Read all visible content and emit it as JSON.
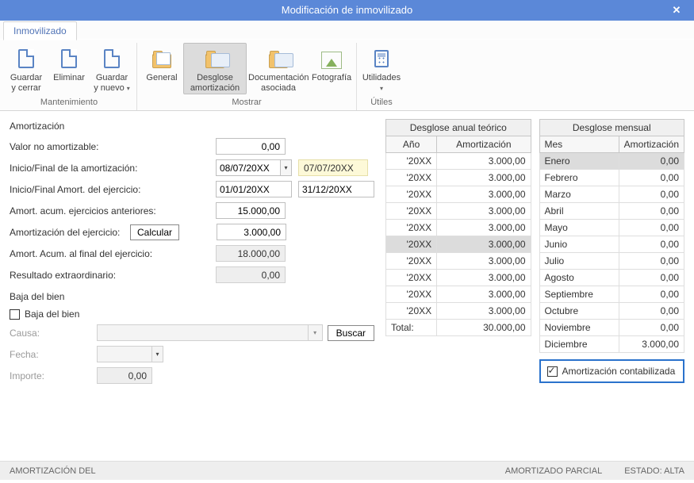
{
  "window": {
    "title": "Modificación de inmovilizado"
  },
  "tabs": {
    "main": "Inmovilizado"
  },
  "ribbon": {
    "groups": [
      {
        "title": "Mantenimiento",
        "items": [
          {
            "id": "guardar-cerrar",
            "line1": "Guardar",
            "line2": "y cerrar"
          },
          {
            "id": "eliminar",
            "line1": "Eliminar",
            "line2": ""
          },
          {
            "id": "guardar-nuevo",
            "line1": "Guardar",
            "line2": "y nuevo",
            "drop": true
          }
        ]
      },
      {
        "title": "Mostrar",
        "items": [
          {
            "id": "general",
            "line1": "General",
            "line2": ""
          },
          {
            "id": "desglose-amort",
            "line1": "Desglose",
            "line2": "amortización",
            "active": true
          },
          {
            "id": "documentacion",
            "line1": "Documentación",
            "line2": "asociada"
          },
          {
            "id": "fotografia",
            "line1": "Fotografía",
            "line2": ""
          }
        ]
      },
      {
        "title": "Útiles",
        "items": [
          {
            "id": "utilidades",
            "line1": "Utilidades",
            "line2": "",
            "drop": true
          }
        ]
      }
    ]
  },
  "amort": {
    "section": "Amortización",
    "labels": {
      "valorNoAmort": "Valor no amortizable:",
      "inicioFinal": "Inicio/Final de la amortización:",
      "inicioFinalEj": "Inicio/Final Amort. del ejercicio:",
      "acumAnt": "Amort. acum. ejercicios anteriores:",
      "amortEj": "Amortización del ejercicio:",
      "acumFinal": "Amort. Acum. al final del ejercicio:",
      "resultExtra": "Resultado extraordinario:",
      "calcular": "Calcular"
    },
    "values": {
      "valorNoAmort": "0,00",
      "inicioFecha": "08/07/20XX",
      "finalFecha": "07/07/20XX",
      "inicioEj": "01/01/20XX",
      "finalEj": "31/12/20XX",
      "acumAnt": "15.000,00",
      "amortEj": "3.000,00",
      "acumFinal": "18.000,00",
      "resultExtra": "0,00"
    }
  },
  "baja": {
    "section": "Baja del bien",
    "checkLabel": "Baja del bien",
    "causa": "Causa:",
    "fecha": "Fecha:",
    "importe": "Importe:",
    "buscar": "Buscar",
    "importeVal": "0,00"
  },
  "anual": {
    "title": "Desglose anual teórico",
    "cols": {
      "ano": "Año",
      "amort": "Amortización"
    },
    "rows": [
      {
        "ano": "'20XX",
        "amort": "3.000,00"
      },
      {
        "ano": "'20XX",
        "amort": "3.000,00"
      },
      {
        "ano": "'20XX",
        "amort": "3.000,00"
      },
      {
        "ano": "'20XX",
        "amort": "3.000,00"
      },
      {
        "ano": "'20XX",
        "amort": "3.000,00"
      },
      {
        "ano": "'20XX",
        "amort": "3.000,00",
        "sel": true
      },
      {
        "ano": "'20XX",
        "amort": "3.000,00"
      },
      {
        "ano": "'20XX",
        "amort": "3.000,00"
      },
      {
        "ano": "'20XX",
        "amort": "3.000,00"
      },
      {
        "ano": "'20XX",
        "amort": "3.000,00"
      }
    ],
    "total": {
      "label": "Total:",
      "value": "30.000,00"
    }
  },
  "mensual": {
    "title": "Desglose mensual",
    "cols": {
      "mes": "Mes",
      "amort": "Amortización"
    },
    "rows": [
      {
        "mes": "Enero",
        "amort": "0,00",
        "sel": true
      },
      {
        "mes": "Febrero",
        "amort": "0,00"
      },
      {
        "mes": "Marzo",
        "amort": "0,00"
      },
      {
        "mes": "Abril",
        "amort": "0,00"
      },
      {
        "mes": "Mayo",
        "amort": "0,00"
      },
      {
        "mes": "Junio",
        "amort": "0,00"
      },
      {
        "mes": "Julio",
        "amort": "0,00"
      },
      {
        "mes": "Agosto",
        "amort": "0,00"
      },
      {
        "mes": "Septiembre",
        "amort": "0,00"
      },
      {
        "mes": "Octubre",
        "amort": "0,00"
      },
      {
        "mes": "Noviembre",
        "amort": "0,00"
      },
      {
        "mes": "Diciembre",
        "amort": "3.000,00"
      }
    ],
    "contab": "Amortización contabilizada"
  },
  "status": {
    "left": "AMORTIZACIÓN DEL",
    "mid": "AMORTIZADO PARCIAL",
    "right": "ESTADO: ALTA"
  }
}
